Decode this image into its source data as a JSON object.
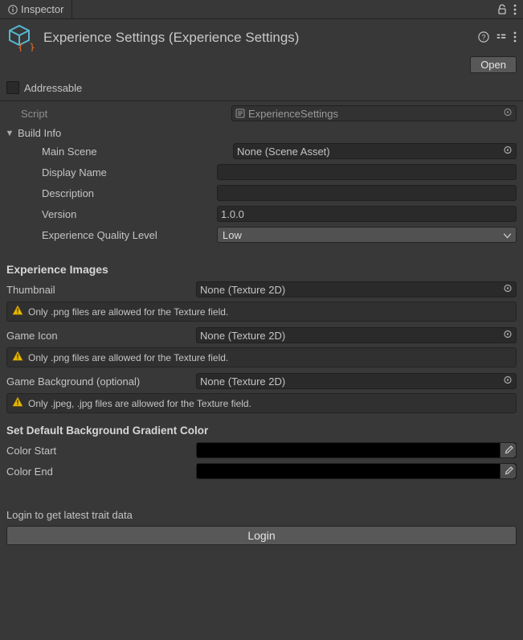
{
  "tab": {
    "title": "Inspector"
  },
  "header": {
    "title": "Experience Settings (Experience Settings)",
    "open_label": "Open"
  },
  "addressable": {
    "label": "Addressable"
  },
  "script": {
    "label": "Script",
    "value": "ExperienceSettings"
  },
  "buildInfo": {
    "label": "Build Info",
    "mainScene": {
      "label": "Main Scene",
      "value": "None (Scene Asset)"
    },
    "displayName": {
      "label": "Display Name",
      "value": ""
    },
    "description": {
      "label": "Description",
      "value": ""
    },
    "version": {
      "label": "Version",
      "value": "1.0.0"
    },
    "qualityLevel": {
      "label": "Experience Quality Level",
      "value": "Low"
    }
  },
  "images": {
    "title": "Experience Images",
    "thumbnail": {
      "label": "Thumbnail",
      "value": "None (Texture 2D)",
      "warning": "Only .png files are allowed for the Texture field."
    },
    "gameIcon": {
      "label": "Game Icon",
      "value": "None (Texture 2D)",
      "warning": "Only .png files are allowed for the Texture field."
    },
    "gameBackground": {
      "label": "Game Background (optional)",
      "value": "None (Texture 2D)",
      "warning": "Only .jpeg, .jpg files are allowed for the Texture field."
    }
  },
  "gradient": {
    "title": "Set Default Background Gradient Color",
    "colorStart": {
      "label": "Color Start",
      "value": "#000000"
    },
    "colorEnd": {
      "label": "Color End",
      "value": "#000000"
    }
  },
  "login": {
    "message": "Login to get latest trait data",
    "button": "Login"
  }
}
